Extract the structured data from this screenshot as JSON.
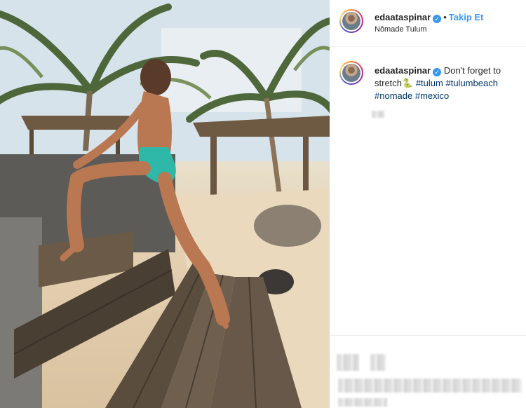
{
  "post": {
    "username": "edaataspinar",
    "verified_icon": "verified-badge-icon",
    "separator": "•",
    "follow_label": "Takip Et",
    "location": "Nômade Tulum"
  },
  "caption": {
    "username": "edaataspinar",
    "text_1": "Don't forget to",
    "text_2": "stretch",
    "emoji": "🐍",
    "tags": [
      "#tulum",
      "#tulumbeach",
      "#nomade",
      "#mexico"
    ]
  },
  "colors": {
    "link": "#3897f0",
    "hashtag": "#003569",
    "divider": "#efefef"
  }
}
